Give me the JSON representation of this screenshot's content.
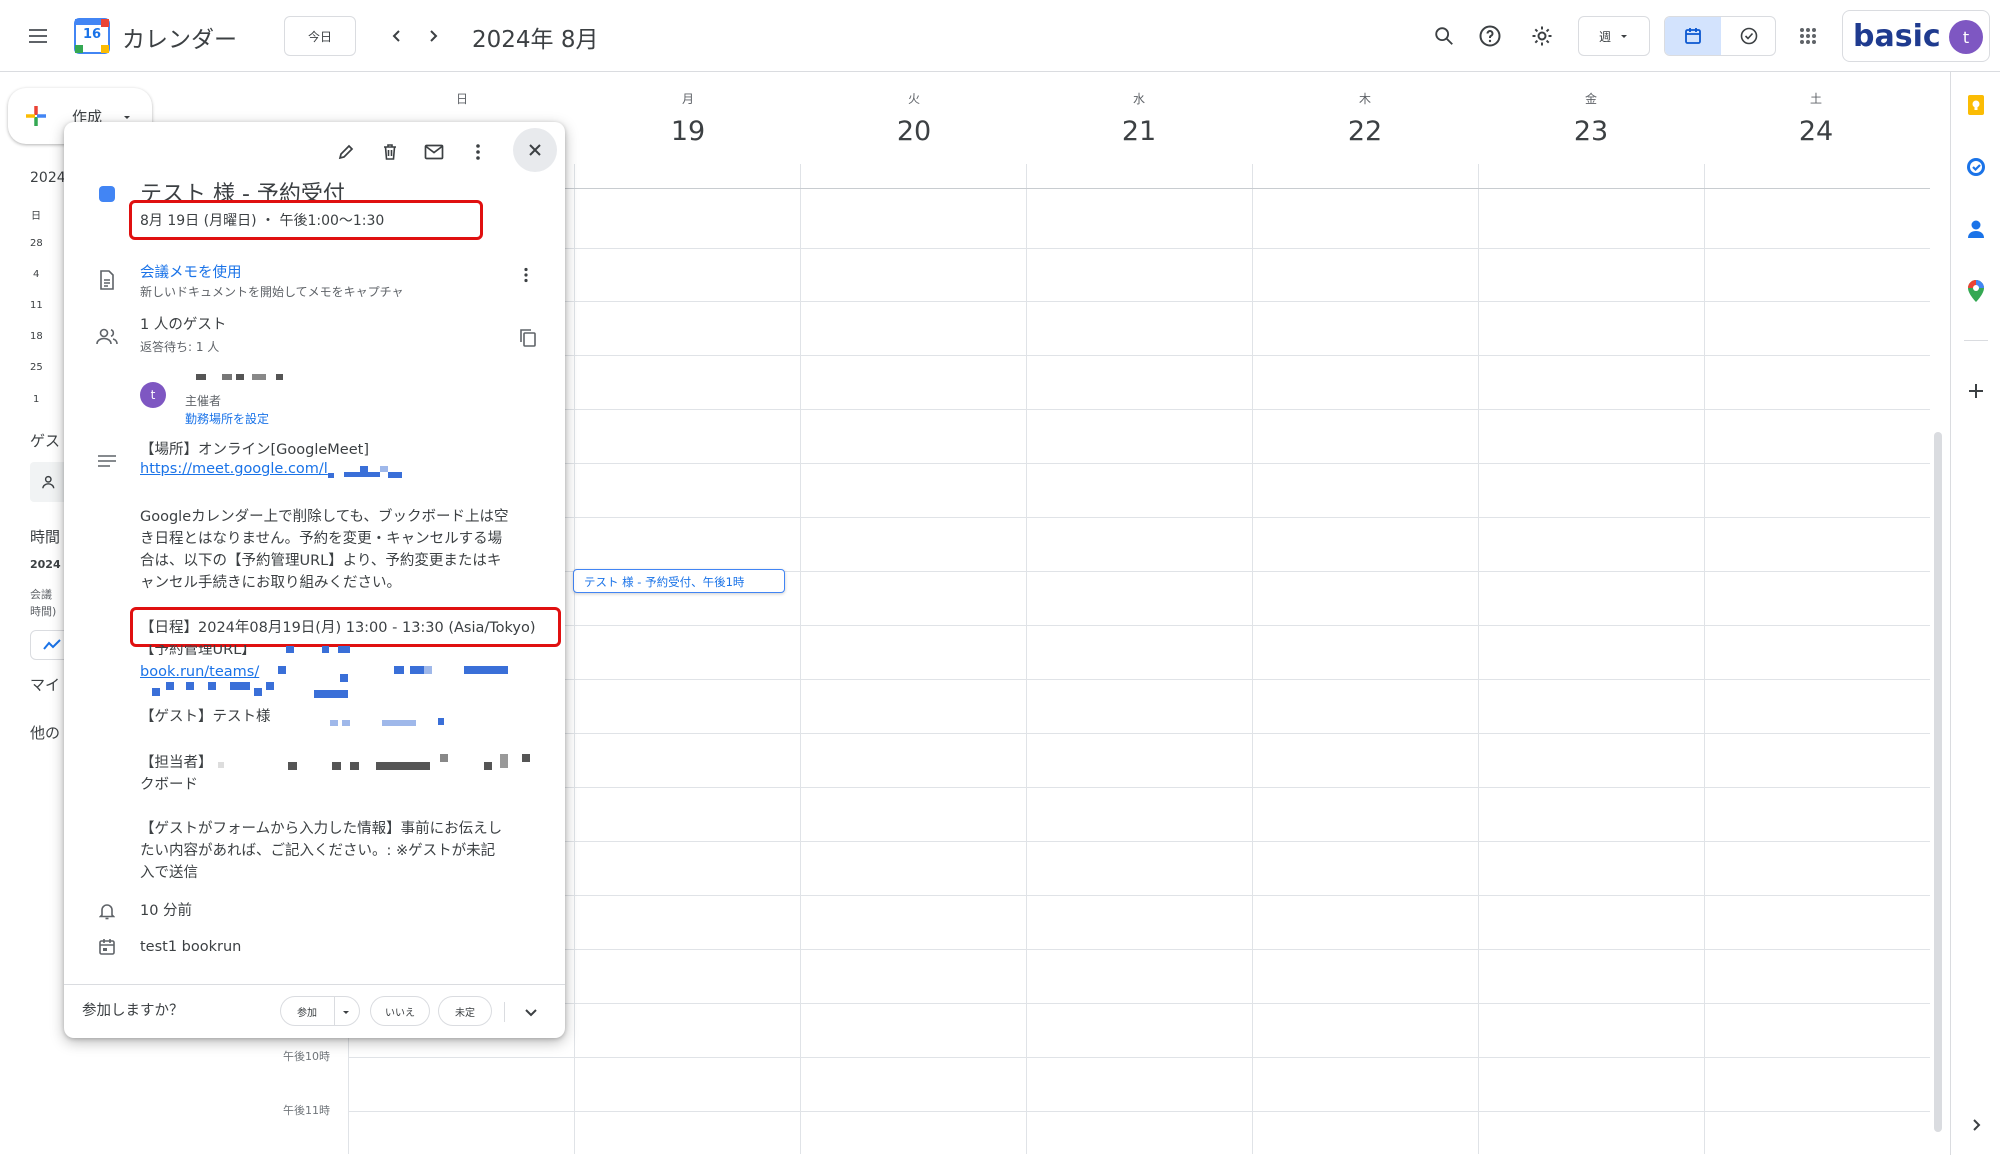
{
  "app": {
    "title": "カレンダー",
    "logo_day": "16"
  },
  "header": {
    "today_label": "今日",
    "period": "2024年 8月",
    "view_label": "週",
    "brand": "basic",
    "avatar_letter": "t"
  },
  "week": {
    "days": [
      {
        "name": "日",
        "num": ""
      },
      {
        "name": "月",
        "num": "19"
      },
      {
        "name": "火",
        "num": "20"
      },
      {
        "name": "水",
        "num": "21"
      },
      {
        "name": "木",
        "num": "22"
      },
      {
        "name": "金",
        "num": "23"
      },
      {
        "name": "土",
        "num": "24"
      }
    ],
    "time_labels": [
      "午後10時",
      "午後11時"
    ]
  },
  "sidebar": {
    "create_label": "作成",
    "mini_header": "2024",
    "mini_dayname": "日",
    "mini_dates": [
      "28",
      "4",
      "11",
      "18",
      "25",
      "1"
    ],
    "guest_section": "ゲス",
    "time_section": "時間",
    "time_year": "2024",
    "memo_line1": "会議",
    "memo_line2": "時間)",
    "my_calendars": "マイ",
    "other_calendars": "他の"
  },
  "event_chip": {
    "label": "テスト 様 - 予約受付、午後1時"
  },
  "popup": {
    "title": "テスト 様 - 予約受付",
    "datetime": "8月 19日 (月曜日) ・ 午後1:00〜1:30",
    "notes_link": "会議メモを使用",
    "notes_sub": "新しいドキュメントを開始してメモをキャプチャ",
    "guests_count": "1 人のゲスト",
    "guests_awaiting": "返答待ち: 1 人",
    "guest_avatar_letter": "t",
    "guest_role": "主催者",
    "guest_location_link": "勤務場所を設定",
    "desc_location": "【場所】オンライン[GoogleMeet]",
    "desc_meet_link": "https://meet.google.com/l",
    "desc_para1_l1": "Googleカレンダー上で削除しても、ブックボード上は空",
    "desc_para1_l2": "き日程とはなりません。予約を変更・キャンセルする場",
    "desc_para1_l3": "合は、以下の【予約管理URL】より、予約変更またはキ",
    "desc_para1_l4": "ャンセル手続きにお取り組みください。",
    "desc_schedule": "【日程】2024年08月19日(月) 13:00 - 13:30 (Asia/Tokyo)",
    "desc_manage_url_label": "【予約管理URL】",
    "desc_manage_url": "book.run/teams/",
    "desc_guest": "【ゲスト】テスト様",
    "desc_staff": "【担当者】",
    "desc_staff_l2": "クボード",
    "desc_form_l1": "【ゲストがフォームから入力した情報】事前にお伝えし",
    "desc_form_l2": "たい内容があれば、ご記入ください。: ※ゲストが未記",
    "desc_form_l3": "入で送信",
    "reminder": "10 分前",
    "calendar_name": "test1 bookrun",
    "rsvp_question": "参加しますか？",
    "rsvp_yes": "参加",
    "rsvp_no": "いいえ",
    "rsvp_maybe": "未定"
  },
  "colors": {
    "accent": "#1a73e8",
    "event": "#4285f4",
    "highlight": "#e01010"
  }
}
